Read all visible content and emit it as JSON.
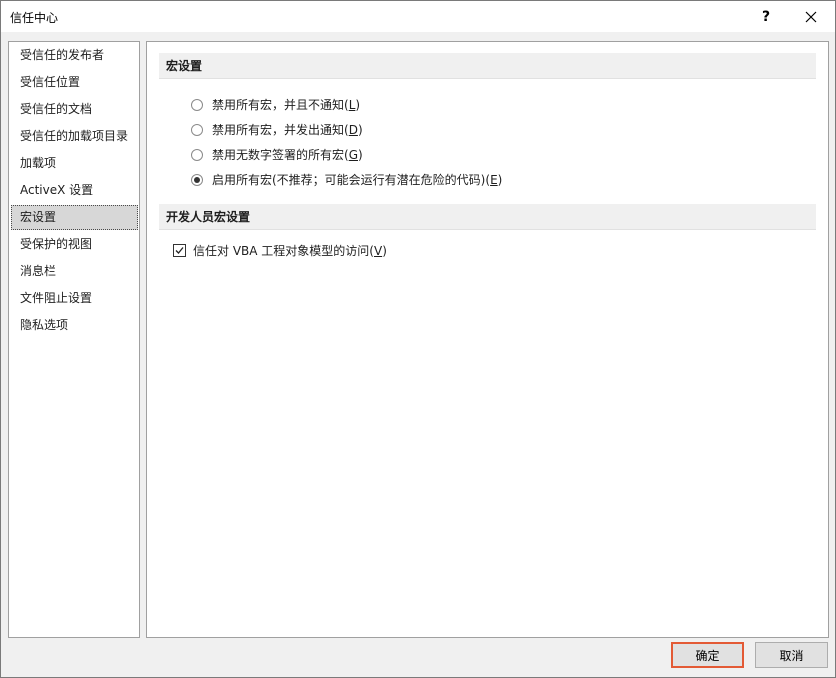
{
  "window": {
    "title": "信任中心",
    "help_label": "?"
  },
  "sidebar": {
    "items": [
      {
        "label": "受信任的发布者"
      },
      {
        "label": "受信任位置"
      },
      {
        "label": "受信任的文档"
      },
      {
        "label": "受信任的加载项目录"
      },
      {
        "label": "加载项"
      },
      {
        "label": "ActiveX 设置"
      },
      {
        "label": "宏设置",
        "selected": true
      },
      {
        "label": "受保护的视图"
      },
      {
        "label": "消息栏"
      },
      {
        "label": "文件阻止设置"
      },
      {
        "label": "隐私选项"
      }
    ]
  },
  "macro_settings": {
    "header": "宏设置",
    "options": [
      {
        "text": "禁用所有宏，并且不通知(",
        "key": "L",
        "close": ")",
        "checked": false
      },
      {
        "text": "禁用所有宏，并发出通知(",
        "key": "D",
        "close": ")",
        "checked": false
      },
      {
        "text": "禁用无数字签署的所有宏(",
        "key": "G",
        "close": ")",
        "checked": false
      },
      {
        "text": "启用所有宏(不推荐；可能会运行有潜在危险的代码)(",
        "key": "E",
        "close": ")",
        "checked": true
      }
    ]
  },
  "developer_settings": {
    "header": "开发人员宏设置",
    "vba_access": {
      "text": "信任对 VBA 工程对象模型的访问(",
      "key": "V",
      "close": ")",
      "checked": true
    }
  },
  "buttons": {
    "ok": "确定",
    "cancel": "取消"
  }
}
